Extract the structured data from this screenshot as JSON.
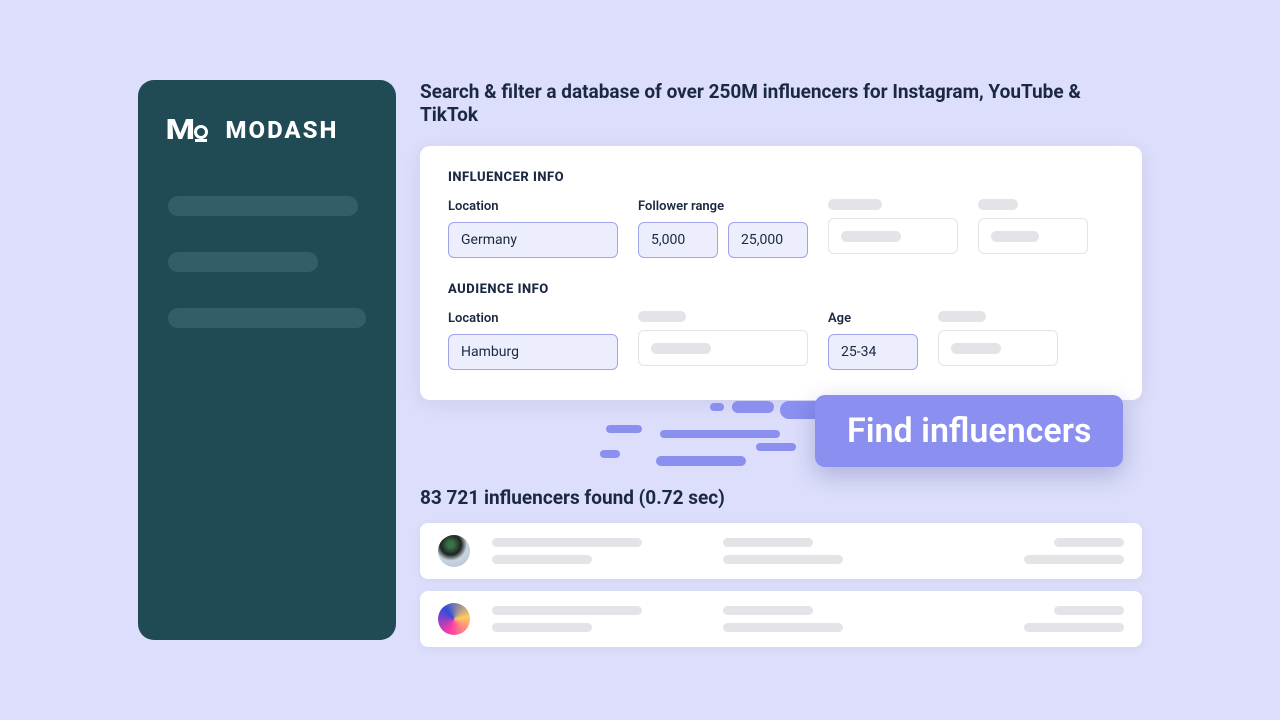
{
  "brand": {
    "name": "MODASH"
  },
  "main": {
    "heading": "Search & filter a database of over 250M influencers for Instagram, YouTube & TikTok",
    "influencer": {
      "title": "INFLUENCER INFO",
      "location_label": "Location",
      "location_value": "Germany",
      "follower_label": "Follower range",
      "follower_min": "5,000",
      "follower_max": "25,000"
    },
    "audience": {
      "title": "AUDIENCE INFO",
      "location_label": "Location",
      "location_value": "Hamburg",
      "age_label": "Age",
      "age_value": "25-34"
    },
    "cta_label": "Find influencers"
  },
  "results": {
    "summary": "83 721 influencers found (0.72 sec)"
  }
}
